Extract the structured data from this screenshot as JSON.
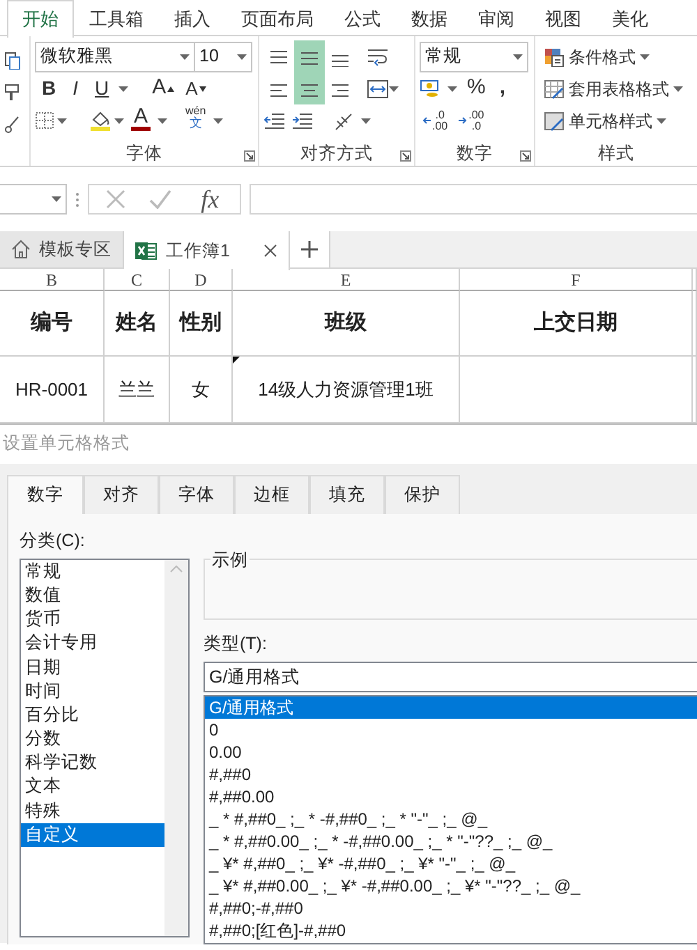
{
  "ribbon_tabs": [
    {
      "label": "开始",
      "selected": true
    },
    {
      "label": "工具箱",
      "selected": false
    },
    {
      "label": "插入",
      "selected": false
    },
    {
      "label": "页面布局",
      "selected": false
    },
    {
      "label": "公式",
      "selected": false
    },
    {
      "label": "数据",
      "selected": false
    },
    {
      "label": "审阅",
      "selected": false
    },
    {
      "label": "视图",
      "selected": false
    },
    {
      "label": "美化",
      "selected": false
    }
  ],
  "font_group": {
    "label": "字体",
    "font_name": "微软雅黑",
    "font_size": "10",
    "style_buttons": [
      "B",
      "I",
      "U"
    ],
    "grow_button": "A",
    "shrink_button": "A",
    "color_button": "A",
    "phonetic_button": {
      "top": "wén",
      "bottom": "文"
    }
  },
  "align_group": {
    "label": "对齐方式",
    "align_buttons": [
      {
        "selected": false
      },
      {
        "selected": true
      },
      {
        "selected": false
      },
      {
        "selected": false
      },
      {
        "selected": true
      },
      {
        "selected": false
      }
    ]
  },
  "number_group": {
    "label": "数字",
    "format": "常规",
    "percent_button": "%",
    "comma_button": ",",
    "decimal_buttons": [
      {
        "top": ".0",
        "bottom": ".00"
      },
      {
        "top": ".00",
        "bottom": ".0"
      }
    ]
  },
  "styles_group": {
    "label": "样式",
    "items": [
      "条件格式",
      "套用表格格式",
      "单元格样式"
    ]
  },
  "formula_bar": {
    "function_button": "fx"
  },
  "doc_tabs": [
    {
      "label": "模板专区",
      "kind": "home",
      "selected": false
    },
    {
      "label": "工作簿1",
      "kind": "workbook",
      "selected": true
    }
  ],
  "sheet": {
    "columns": [
      "B",
      "C",
      "D",
      "E",
      "F"
    ],
    "rows": [
      {
        "kind": "header",
        "cells": [
          "编号",
          "姓名",
          "性别",
          "班级",
          "上交日期"
        ]
      },
      {
        "kind": "data",
        "cells": [
          "HR-0001",
          "兰兰",
          "女",
          "14级人力资源管理1班",
          null
        ]
      }
    ]
  },
  "dialog": {
    "title": "设置单元格格式",
    "tabs": [
      {
        "label": "数字",
        "selected": true
      },
      {
        "label": "对齐",
        "selected": false
      },
      {
        "label": "字体",
        "selected": false
      },
      {
        "label": "边框",
        "selected": false
      },
      {
        "label": "填充",
        "selected": false
      },
      {
        "label": "保护",
        "selected": false
      }
    ],
    "category_label": "分类(C):",
    "categories": [
      {
        "label": "常规",
        "selected": false
      },
      {
        "label": "数值",
        "selected": false
      },
      {
        "label": "货币",
        "selected": false
      },
      {
        "label": "会计专用",
        "selected": false
      },
      {
        "label": "日期",
        "selected": false
      },
      {
        "label": "时间",
        "selected": false
      },
      {
        "label": "百分比",
        "selected": false
      },
      {
        "label": "分数",
        "selected": false
      },
      {
        "label": "科学记数",
        "selected": false
      },
      {
        "label": "文本",
        "selected": false
      },
      {
        "label": "特殊",
        "selected": false
      },
      {
        "label": "自定义",
        "selected": true
      }
    ],
    "sample_label": "示例",
    "type_label": "类型(T):",
    "type_value": "G/通用格式",
    "formats": [
      {
        "label": "G/通用格式",
        "selected": true
      },
      {
        "label": "0",
        "selected": false
      },
      {
        "label": "0.00",
        "selected": false
      },
      {
        "label": "#,##0",
        "selected": false
      },
      {
        "label": "#,##0.00",
        "selected": false
      },
      {
        "label": "_ * #,##0_ ;_ * -#,##0_ ;_ * \"-\"_ ;_ @_",
        "selected": false
      },
      {
        "label": "_ * #,##0.00_ ;_ * -#,##0.00_ ;_ * \"-\"??_ ;_ @_",
        "selected": false
      },
      {
        "label": "_ ¥* #,##0_ ;_ ¥* -#,##0_ ;_ ¥* \"-\"_ ;_ @_",
        "selected": false
      },
      {
        "label": "_ ¥* #,##0.00_ ;_ ¥* -#,##0.00_ ;_ ¥* \"-\"??_ ;_ @_",
        "selected": false
      },
      {
        "label": "#,##0;-#,##0",
        "selected": false
      },
      {
        "label": "#,##0;[红色]-#,##0",
        "selected": false
      }
    ]
  }
}
